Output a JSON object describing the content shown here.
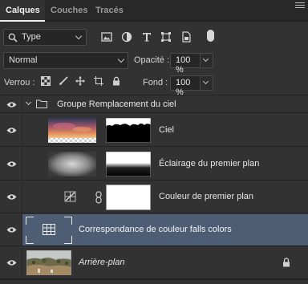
{
  "tabs": [
    {
      "label": "Calques",
      "active": true
    },
    {
      "label": "Couches",
      "active": false
    },
    {
      "label": "Tracés",
      "active": false
    }
  ],
  "filter": {
    "kind_label": "Type",
    "icons": [
      "image-filter-icon",
      "adjustment-filter-icon",
      "text-filter-icon",
      "shape-filter-icon",
      "smart-object-filter-icon",
      "filter-toggle"
    ]
  },
  "blend": {
    "mode": "Normal",
    "opacity_label": "Opacité :",
    "opacity_value": "100 %"
  },
  "lock": {
    "label": "Verrou :",
    "fill_label": "Fond :",
    "fill_value": "100 %"
  },
  "layers": [
    {
      "name": "Groupe Remplacement du ciel",
      "type": "group",
      "expanded": true
    },
    {
      "name": "Ciel",
      "type": "pixel-with-mask",
      "clipped": true
    },
    {
      "name": "Éclairage du premier plan",
      "type": "pixel-with-mask",
      "clipped": true
    },
    {
      "name": "Couleur de premier plan",
      "type": "adjustment-with-mask",
      "clipped": true
    },
    {
      "name": "Correspondance de couleur falls colors",
      "type": "lookup-adjustment",
      "selected": true
    },
    {
      "name": "Arrière-plan",
      "type": "background",
      "locked": true
    }
  ],
  "colors": {
    "panel_bg": "#323232",
    "selected_row": "#4d5e74",
    "tab_bg": "#282828"
  }
}
